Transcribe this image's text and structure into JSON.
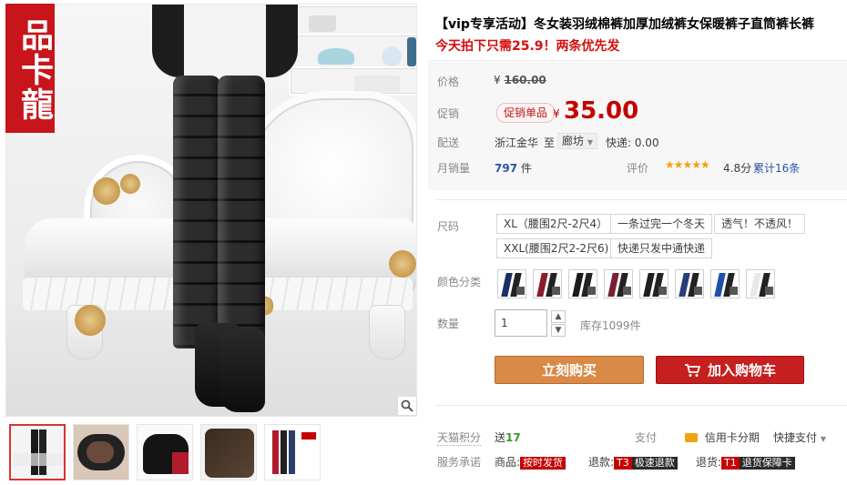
{
  "brand": {
    "logo_text": "品卡龍"
  },
  "product": {
    "title": "【vip专享活动】冬女装羽绒棉裤加厚加绒裤女保暖裤子直筒裤长裤",
    "subtitle": "今天拍下只需25.9！两条优先发"
  },
  "price": {
    "label": "价格",
    "currency": "¥",
    "original": "160.00",
    "promo_label": "促销",
    "promo_tag": "促销单品",
    "current": "35.00"
  },
  "shipping": {
    "label": "配送",
    "from": "浙江金华",
    "to_word": "至",
    "destination": "廊坊",
    "express": "快递: 0.00"
  },
  "sales": {
    "label": "月销量",
    "count": "797",
    "unit": "件",
    "rating_label": "评价",
    "stars": "★★★★★",
    "rating": 4.8,
    "rating_text": "4.8分",
    "reviews_text": "累计16条"
  },
  "size": {
    "label": "尺码",
    "options": [
      "XL（腰围2尺-2尺4）",
      "一条过完一个冬天",
      "透气！不透风！",
      "XXL(腰围2尺2-2尺6)",
      "快递只发中通快递"
    ]
  },
  "color": {
    "label": "颜色分类",
    "count": 8
  },
  "quantity": {
    "label": "数量",
    "value": "1",
    "stock": "库存1099件",
    "up": "▲",
    "down": "▼"
  },
  "actions": {
    "buy": "立刻购买",
    "cart": "加入购物车"
  },
  "bottom": {
    "points_label": "天猫积分",
    "points_prefix": "送",
    "points_value": "17",
    "pay_label": "支付",
    "credit": "信用卡分期",
    "quick_pay": "快捷支付",
    "service_label": "服务承诺",
    "goods_label": "商品:",
    "goods_tag": "按时发货",
    "refund_label": "退款:",
    "refund_code": "T3",
    "refund_tag": "极速退款",
    "return_label": "退货:",
    "return_code": "T1",
    "return_tag": "退货保障卡"
  },
  "colors": {
    "accent_red": "#c40000",
    "buy_orange": "#d98a47",
    "cart_red": "#c51f1f",
    "star": "#f2a10f"
  },
  "icons": [
    "search-icon",
    "cart-icon",
    "card-icon",
    "chevron-down-icon"
  ]
}
